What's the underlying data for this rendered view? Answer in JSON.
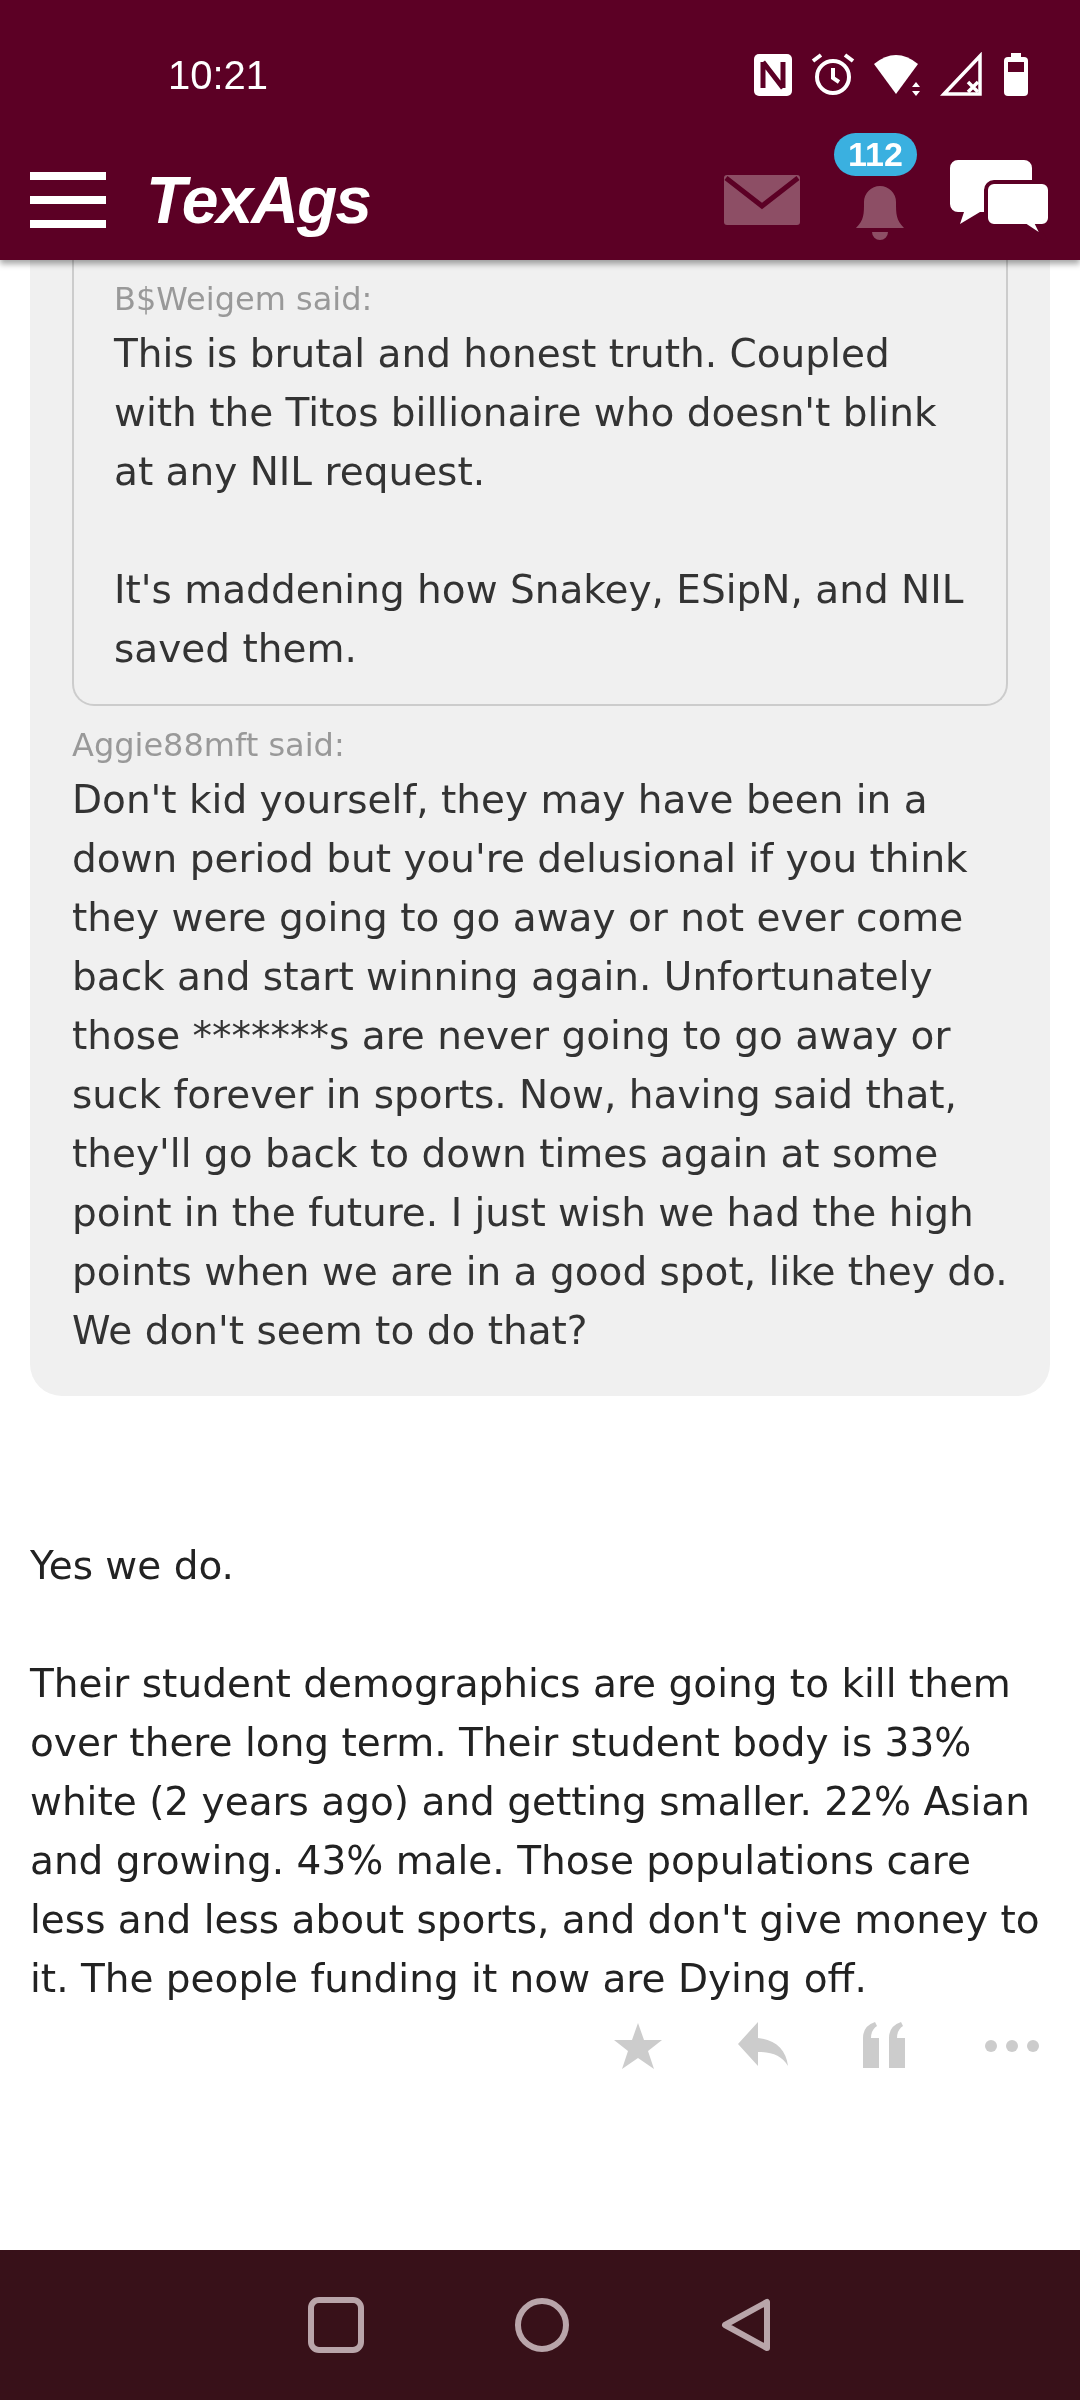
{
  "status_bar": {
    "time": "10:21"
  },
  "app_bar": {
    "logo": "TexAgs",
    "notification_count": "112"
  },
  "quote": {
    "author_label": "Aggie88mft said:",
    "nested_quote": {
      "author_label": "B$Weigem said:",
      "paragraphs": [
        "This is brutal and honest truth. Coupled with the Titos billionaire who doesn't blink at any NIL request.",
        "It's maddening how Snakey, ESipN, and NIL saved them."
      ]
    },
    "paragraphs": [
      "Don't kid yourself, they may have been in a down period but you're delusional if you think they were going to go away or not ever come back and start winning again. Unfortunately those *******s are never going to go away or suck forever in sports. Now, having said that, they'll go back to down times again at some point in the future. I just wish we had the high points when we are in a good spot, like they do. We don't seem to do that?"
    ]
  },
  "post": {
    "paragraphs": [
      "Yes we do.",
      "Their student demographics are going to kill them over there long term. Their student body is 33% white (2 years ago) and getting smaller. 22% Asian and growing. 43% male. Those populations care less and less about sports, and don't give money to it. The people funding it now are Dying off."
    ]
  }
}
